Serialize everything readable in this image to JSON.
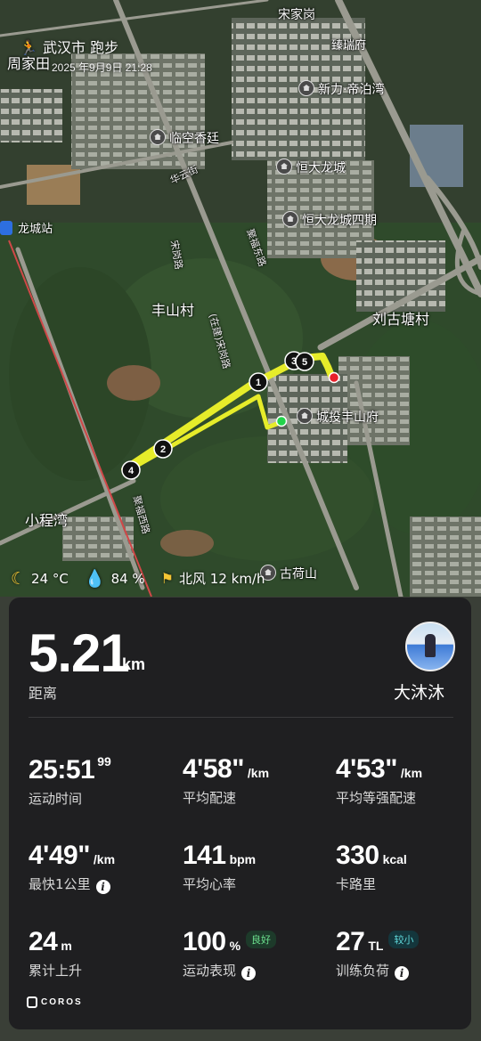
{
  "header": {
    "title": "武汉市 跑步",
    "datetime": "2025 年9月9日 21:28"
  },
  "map": {
    "pois": [
      "臻瑞府",
      "宋家岗",
      "新力·帝泊湾",
      "临空香廷",
      "恒大龙城",
      "恒大龙城四期",
      "城投丰山府",
      "古荷山"
    ],
    "villages": [
      "周家田",
      "丰山村",
      "刘古塘村",
      "小程湾"
    ],
    "roads": [
      "华云街",
      "宋岗路",
      "聚福东路",
      "(在建)宋岗路",
      "聚福西路"
    ],
    "station": "龙城站",
    "markers": [
      "1",
      "2",
      "3",
      "4",
      "5"
    ]
  },
  "weather": {
    "temp": "24 °C",
    "humidity": "84 %",
    "wind": "北风 12 km/h"
  },
  "summary": {
    "distance_value": "5.21",
    "distance_unit": "km",
    "distance_label": "距离",
    "username": "大沐沐"
  },
  "stats": {
    "time": {
      "value": "25:51",
      "sup": "99",
      "label": "运动时间"
    },
    "avg_pace": {
      "value": "4'58\"",
      "unit": "/km",
      "label": "平均配速"
    },
    "grade_pace": {
      "value": "4'53\"",
      "unit": "/km",
      "label": "平均等强配速"
    },
    "fastest_km": {
      "value": "4'49\"",
      "unit": "/km",
      "label": "最快1公里"
    },
    "heart_rate": {
      "value": "141",
      "unit": "bpm",
      "label": "平均心率"
    },
    "calories": {
      "value": "330",
      "unit": "kcal",
      "label": "卡路里"
    },
    "ascent": {
      "value": "24",
      "unit": "m",
      "label": "累计上升"
    },
    "performance": {
      "value": "100",
      "unit": "%",
      "badge": "良好",
      "label": "运动表现"
    },
    "training_load": {
      "value": "27",
      "unit": "TL",
      "badge": "较小",
      "label": "训练负荷"
    }
  },
  "brand": "COROS",
  "colors": {
    "route": "#e6ec2a",
    "start": "#22d34a",
    "end": "#e8202a",
    "card": "#1f1f21"
  }
}
